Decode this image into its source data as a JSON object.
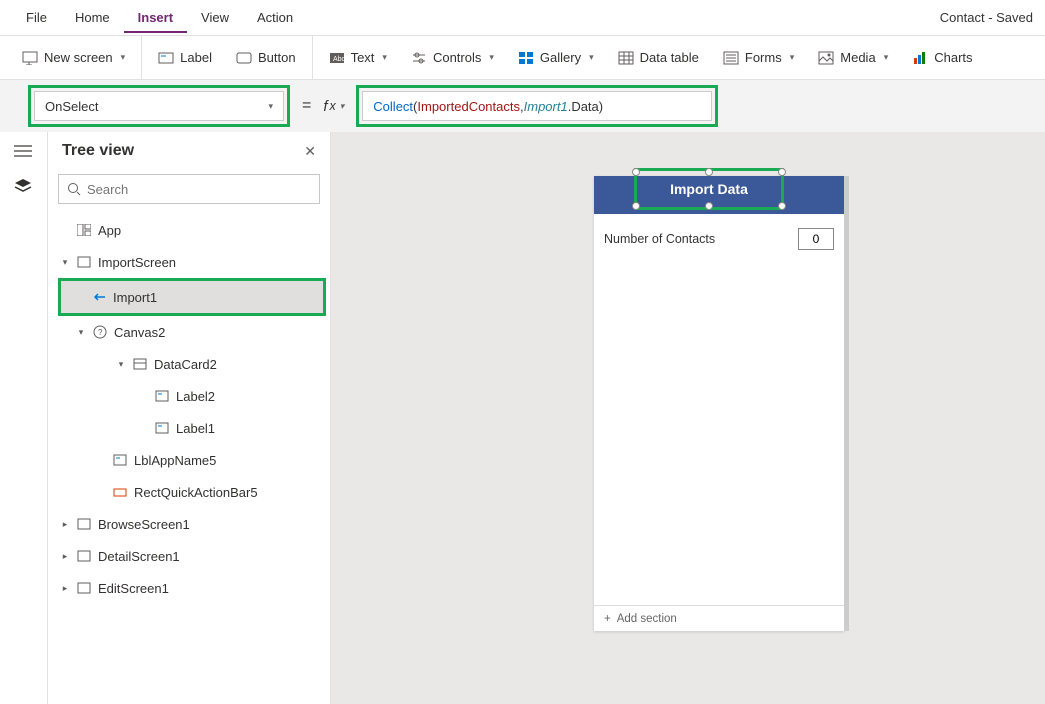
{
  "title": "Contact - Saved",
  "menubar": {
    "items": [
      "File",
      "Home",
      "Insert",
      "View",
      "Action"
    ],
    "active_index": 2
  },
  "ribbon": {
    "new_screen": "New screen",
    "label": "Label",
    "button": "Button",
    "text": "Text",
    "controls": "Controls",
    "gallery": "Gallery",
    "data_table": "Data table",
    "forms": "Forms",
    "media": "Media",
    "charts": "Charts"
  },
  "property_selector": {
    "value": "OnSelect"
  },
  "formula": {
    "fn": "Collect",
    "arg1": "ImportedContacts",
    "arg2_obj": "Import1",
    "arg2_prop": ".Data"
  },
  "tree": {
    "title": "Tree view",
    "search_placeholder": "Search",
    "app": "App",
    "import_screen": "ImportScreen",
    "import1": "Import1",
    "canvas2": "Canvas2",
    "datacard2": "DataCard2",
    "label2": "Label2",
    "label1": "Label1",
    "lblapp": "LblAppName5",
    "rect": "RectQuickActionBar5",
    "browse": "BrowseScreen1",
    "detail": "DetailScreen1",
    "edit": "EditScreen1"
  },
  "canvas": {
    "appbar_title": "Import Data",
    "card_label": "Number of Contacts",
    "card_value": "0",
    "add_section": "Add section"
  },
  "colors": {
    "highlight": "#1aaa55",
    "brand": "#742774",
    "appbar": "#3b5998"
  }
}
